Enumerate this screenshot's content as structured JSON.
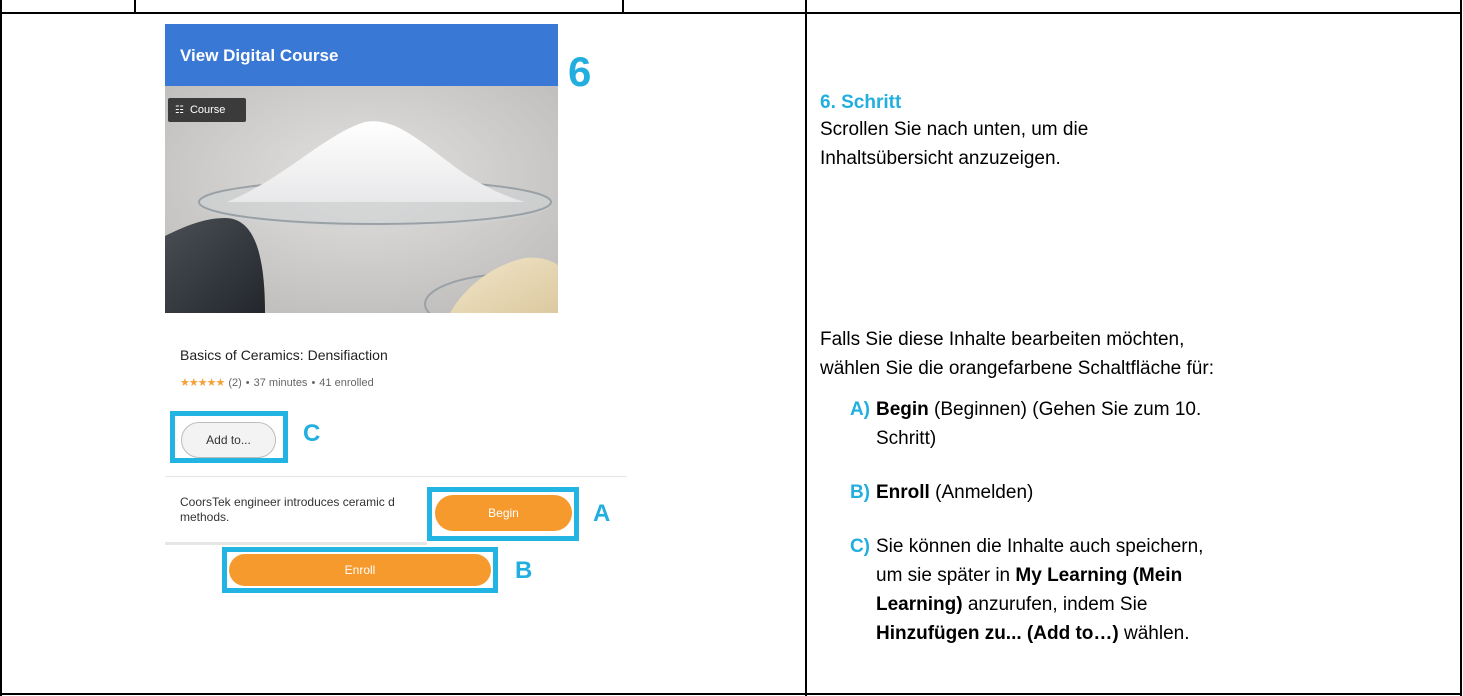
{
  "screenshot": {
    "header_title": "View Digital Course",
    "step_number": "6",
    "chip_label": "Course",
    "course_title": "Basics of Ceramics: Densifiaction",
    "rating_stars": "★★★★★",
    "rating_count": "(2)",
    "dot": "•",
    "duration": "37 minutes",
    "enrolled": "41 enrolled",
    "add_to_label": "Add to...",
    "description": "CoorsTek engineer introduces ceramic d\nmethods.",
    "begin_label": "Begin",
    "enroll_label": "Enroll",
    "markers": {
      "a": "A",
      "b": "B",
      "c": "C"
    }
  },
  "instructions": {
    "step_heading": "6. Schritt",
    "intro_line1": "Scrollen Sie nach unten, um die",
    "intro_line2": "Inhaltsübersicht anzuzeigen.",
    "para_line1": "Falls Sie diese Inhalte bearbeiten möchten,",
    "para_line2": "wählen Sie die orangefarbene Schaltfläche für:",
    "options": [
      {
        "label": "A)",
        "bold": "Begin",
        "rest1": " (Beginnen) (Gehen Sie zum 10.",
        "rest2": "Schritt)"
      },
      {
        "label": "B)",
        "bold": "Enroll",
        "rest1": " (Anmelden)"
      },
      {
        "label": "C)",
        "line1": "Sie können die Inhalte auch speichern,",
        "line2_pre": "um sie später in ",
        "line2_bold": "My Learning (Mein",
        "line3_bold": "Learning)",
        "line3_rest": " anzurufen, indem Sie",
        "line4_bold": "Hinzufügen zu... (Add to…)",
        "line4_rest": " wählen."
      }
    ]
  },
  "colors": {
    "accent": "#23aee0",
    "orange": "#f69a2e",
    "header_blue": "#3a78d6",
    "callout": "#22b5e3"
  }
}
